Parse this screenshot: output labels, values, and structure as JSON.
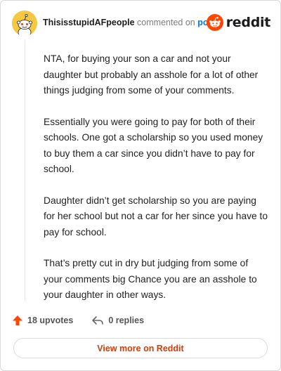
{
  "header": {
    "username": "ThisisstupidAFpeople",
    "action_text": "commented on",
    "post_link": "post",
    "brand_name": "reddit"
  },
  "comment": {
    "paragraphs": [
      "NTA, for buying your son a car and not your daughter but probably an asshole for a lot of other things judging from some of your comments.",
      "Essentially you were going to pay for both of their schools. One got a scholarship so you used money to buy them a car since you didn’t have to pay for school.",
      "Daughter didn’t get scholarship so you are paying for her school but not a car for her since you have to pay for school.",
      "That’s pretty cut in dry but judging from some of your comments big Chance you are an asshole to your daughter in other ways."
    ]
  },
  "footer": {
    "upvotes": "18 upvotes",
    "replies": "0 replies",
    "view_more": "View more on Reddit"
  },
  "colors": {
    "brand_orange": "#ff4500",
    "link_blue": "#0079d3",
    "view_more_text": "#d93a00",
    "avatar_bg": "#f5c842"
  },
  "icons": {
    "avatar": "snoo-avatar",
    "logo": "reddit-snoo-icon",
    "upvote": "upvote-arrow-icon",
    "reply": "reply-arrow-icon"
  }
}
